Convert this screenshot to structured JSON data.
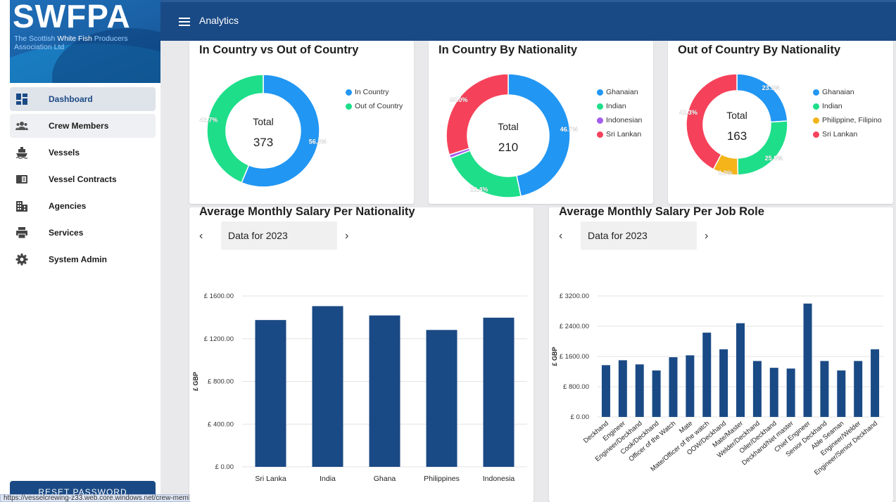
{
  "brand": {
    "name": "SWFPA",
    "tagline_part1": "The Scottish ",
    "tagline_bold": "White Fish",
    "tagline_part2": " Producers Association Ltd"
  },
  "topbar": {
    "title": "Analytics"
  },
  "sidebar": {
    "items": [
      {
        "label": "Dashboard",
        "icon": "dashboard-icon",
        "state": "active"
      },
      {
        "label": "Crew Members",
        "icon": "people-icon",
        "state": "hover"
      },
      {
        "label": "Vessels",
        "icon": "ship-icon",
        "state": ""
      },
      {
        "label": "Vessel Contracts",
        "icon": "contract-icon",
        "state": ""
      },
      {
        "label": "Agencies",
        "icon": "building-icon",
        "state": ""
      },
      {
        "label": "Services",
        "icon": "printer-icon",
        "state": ""
      },
      {
        "label": "System Admin",
        "icon": "gear-icon",
        "state": ""
      }
    ],
    "reset_label": "RESET PASSWORD"
  },
  "status_url": "https://vesselcrewing-z33.web.core.windows.net/crew-members",
  "colors": {
    "primary": "#1a4a85",
    "blue": "#2196f3",
    "green": "#1ede8a",
    "purple": "#a35df0",
    "red": "#f5425a",
    "orange": "#f4b41a",
    "bar": "#1a4a85"
  },
  "chart_data": [
    {
      "type": "pie",
      "title": "In Country vs Out of Country",
      "center_label": "Total",
      "total": "373",
      "labels": [
        "In Country",
        "Out of Country"
      ],
      "values": [
        56.3,
        43.7
      ],
      "value_labels": [
        "56.3%",
        "43.7%"
      ],
      "colors": [
        "#2196f3",
        "#1ede8a"
      ],
      "legend": "right"
    },
    {
      "type": "pie",
      "title": "In Country By Nationality",
      "center_label": "Total",
      "total": "210",
      "labels": [
        "Ghanaian",
        "Indian",
        "Indonesian",
        "Sri Lankan"
      ],
      "values": [
        46.7,
        22.4,
        0.9,
        30.0
      ],
      "value_labels": [
        "46.7%",
        "22.4%",
        "",
        "30.0%"
      ],
      "colors": [
        "#2196f3",
        "#1ede8a",
        "#a35df0",
        "#f5425a"
      ],
      "legend": "right"
    },
    {
      "type": "pie",
      "title": "Out of Country By Nationality",
      "center_label": "Total",
      "total": "163",
      "labels": [
        "Ghanaian",
        "Indian",
        "Philippine, Filipino",
        "Sri Lankan"
      ],
      "values": [
        23.9,
        25.8,
        8.0,
        42.3
      ],
      "value_labels": [
        "23.9%",
        "25.8%",
        "8.0%",
        "42.3%"
      ],
      "colors": [
        "#2196f3",
        "#1ede8a",
        "#f4b41a",
        "#f5425a"
      ],
      "legend": "right"
    },
    {
      "type": "bar",
      "title": "Average Monthly Salary Per Nationality",
      "period_label": "Data for 2023",
      "ylabel": "£ GBP",
      "ylim": [
        0,
        1600
      ],
      "yticks": [
        0,
        400,
        800,
        1200,
        1600
      ],
      "ytick_labels": [
        "£ 0.00",
        "£ 400.00",
        "£ 800.00",
        "£ 1200.00",
        "£ 1600.00"
      ],
      "categories": [
        "Sri Lanka",
        "India",
        "Ghana",
        "Philippines",
        "Indonesia"
      ],
      "values": [
        1375,
        1505,
        1418,
        1282,
        1397
      ],
      "grid": true
    },
    {
      "type": "bar",
      "title": "Average Monthly Salary Per Job Role",
      "period_label": "Data for 2023",
      "ylabel": "£ GBP",
      "ylim": [
        0,
        3200
      ],
      "yticks": [
        0,
        800,
        1600,
        2400,
        3200
      ],
      "ytick_labels": [
        "£ 0.00",
        "£ 800.00",
        "£ 1600.00",
        "£ 2400.00",
        "£ 3200.00"
      ],
      "categories": [
        "Deckhand",
        "Engineer",
        "Engineer/Deckhand",
        "Cook/Deckhand",
        "Officer of the Watch",
        "Mate",
        "Mate/Officer of the watch",
        "OOW/Deckhand",
        "Mate/Master",
        "Welder/Deckhand",
        "Oiler/Deckhand",
        "Deckhand/Net master",
        "Chief Engineer",
        "Senior Deckhand",
        "Able Seaman",
        "Engineer/Welder",
        "Engineer/Senior Deckhand"
      ],
      "values": [
        1370,
        1500,
        1390,
        1230,
        1580,
        1630,
        2230,
        1790,
        2480,
        1480,
        1300,
        1280,
        3000,
        1480,
        1230,
        1480,
        1790
      ],
      "grid": true
    }
  ]
}
